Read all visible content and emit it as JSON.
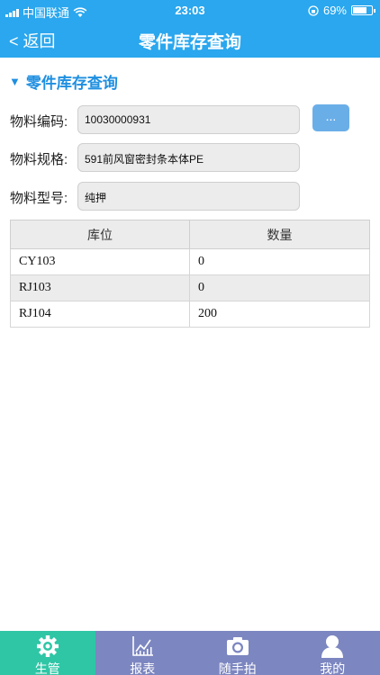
{
  "status_bar": {
    "carrier": "中国联通",
    "time": "23:03",
    "battery_text": "69%",
    "battery_level": 0.69
  },
  "nav": {
    "back_label": "< 返回",
    "title": "零件库存查询"
  },
  "section": {
    "title": "零件库存查询"
  },
  "form": {
    "code_label": "物料编码:",
    "code_value": "10030000931",
    "more_button": "...",
    "spec_label": "物料规格:",
    "spec_value": "591前风窗密封条本体PE",
    "model_label": "物料型号:",
    "model_value": "纯押"
  },
  "table": {
    "headers": [
      "库位",
      "数量"
    ],
    "rows": [
      [
        "CY103",
        "0"
      ],
      [
        "RJ103",
        "0"
      ],
      [
        "RJ104",
        "200"
      ]
    ]
  },
  "tabbar": {
    "items": [
      {
        "label": "生管",
        "icon": "gear-icon",
        "active": true
      },
      {
        "label": "报表",
        "icon": "chart-icon",
        "active": false
      },
      {
        "label": "随手拍",
        "icon": "camera-icon",
        "active": false
      },
      {
        "label": "我的",
        "icon": "user-icon",
        "active": false
      }
    ]
  },
  "colors": {
    "header_blue": "#2aa7ee",
    "section_blue": "#1f8fe0",
    "tab_active": "#2fc6a6",
    "tab_bg": "#7c86c0"
  }
}
